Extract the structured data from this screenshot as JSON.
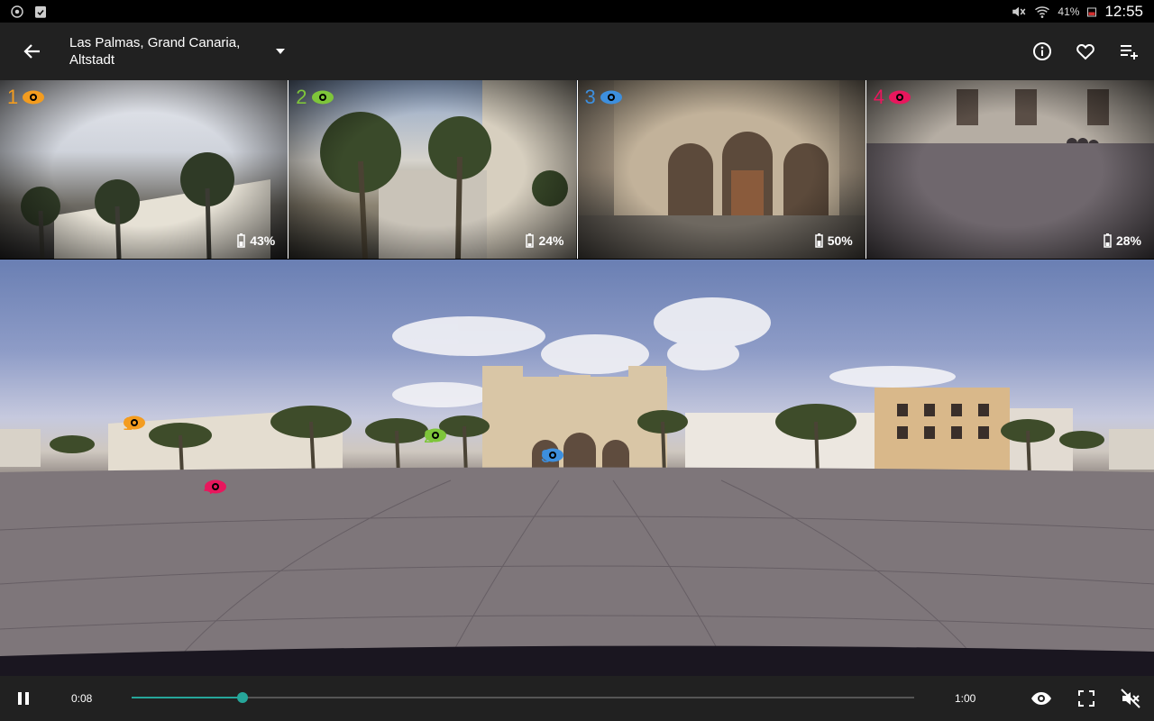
{
  "status_bar": {
    "battery_percent": "41%",
    "time": "12:55",
    "icons": [
      "sync-icon",
      "clipboard-check-icon",
      "mute-icon",
      "wifi-icon",
      "battery-icon"
    ]
  },
  "app_bar": {
    "title_line1": "Las Palmas, Grand Canaria,",
    "title_line2": "Altstadt",
    "actions": [
      "info-icon",
      "heart-icon",
      "playlist-add-icon"
    ]
  },
  "colors": {
    "view1": "#f39c1f",
    "view2": "#7ec53a",
    "view3": "#3d8fde",
    "view4": "#e8175d",
    "accent": "#26a69a"
  },
  "thumbnails": [
    {
      "number": "1",
      "battery": "43%",
      "color": "#f39c1f"
    },
    {
      "number": "2",
      "battery": "24%",
      "color": "#7ec53a"
    },
    {
      "number": "3",
      "battery": "50%",
      "color": "#3d8fde"
    },
    {
      "number": "4",
      "battery": "28%",
      "color": "#e8175d"
    }
  ],
  "panorama_markers": [
    {
      "number": "1",
      "color": "#f39c1f"
    },
    {
      "number": "2",
      "color": "#7ec53a"
    },
    {
      "number": "3",
      "color": "#3d8fde"
    },
    {
      "number": "4",
      "color": "#e8175d"
    }
  ],
  "player": {
    "current_time": "0:08",
    "total_time": "1:00",
    "progress": 0.142,
    "state": "playing"
  }
}
